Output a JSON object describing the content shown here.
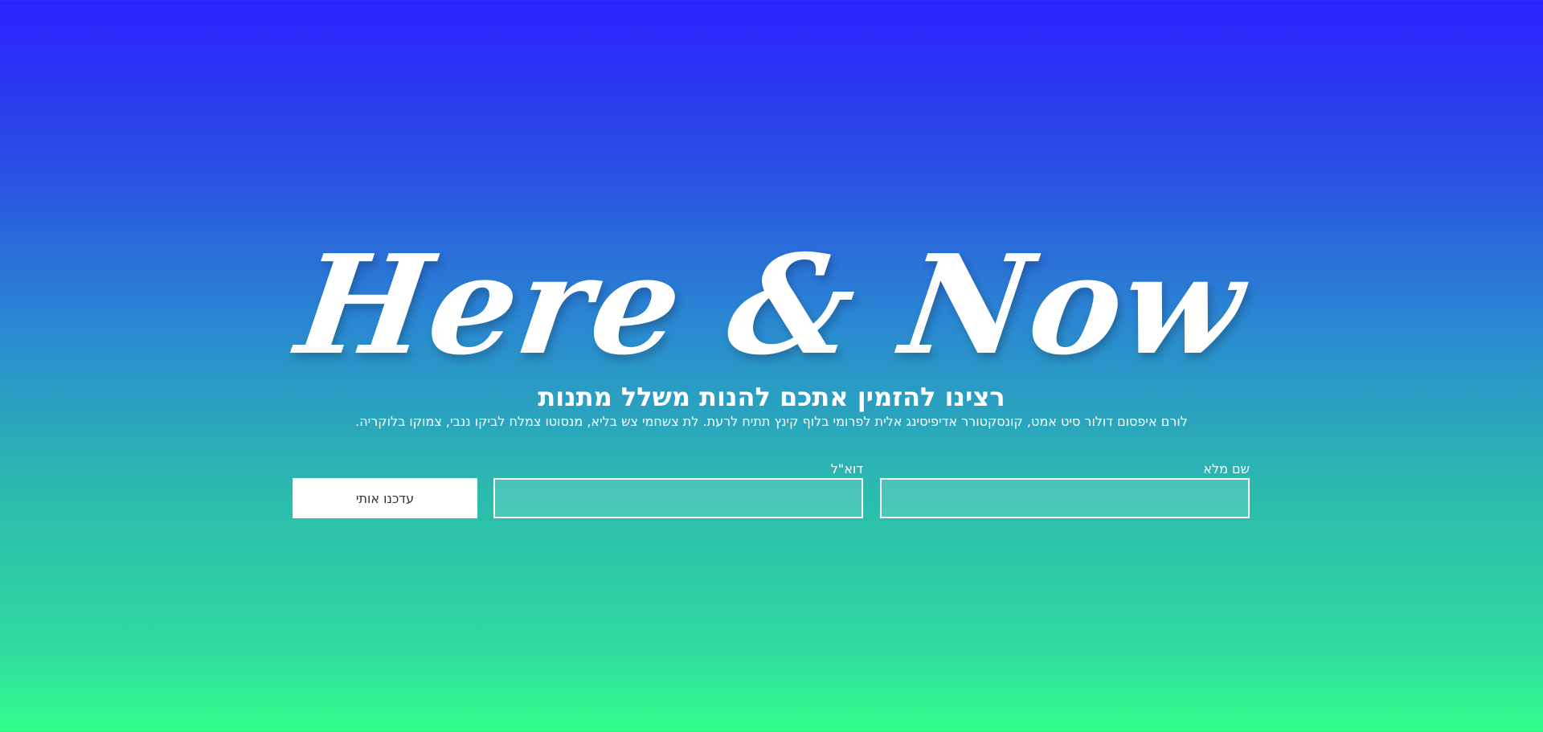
{
  "hero": {
    "logo_text": "Here & Now",
    "headline": "רצינו להזמין אתכם להנות משלל מתנות",
    "subtext": "לורם איפסום דולור סיט אמט, קונסקטורר אדיפיסינג אלית לפרומי בלוף קינץ תתיח לרעת. לת צשחמי צש בליא, מנסוטו צמלח לביקו ננבי, צמוקו בלוקריה."
  },
  "form": {
    "name_label": "שם מלא",
    "name_value": "",
    "email_label": "דוא\"ל",
    "email_value": "",
    "submit_label": "עדכנו אותי"
  },
  "colors": {
    "gradient_top": "#2a22ff",
    "gradient_bottom": "#32ff8a",
    "text": "#ffffff",
    "button_background": "#ffffff",
    "button_text": "#333333"
  }
}
